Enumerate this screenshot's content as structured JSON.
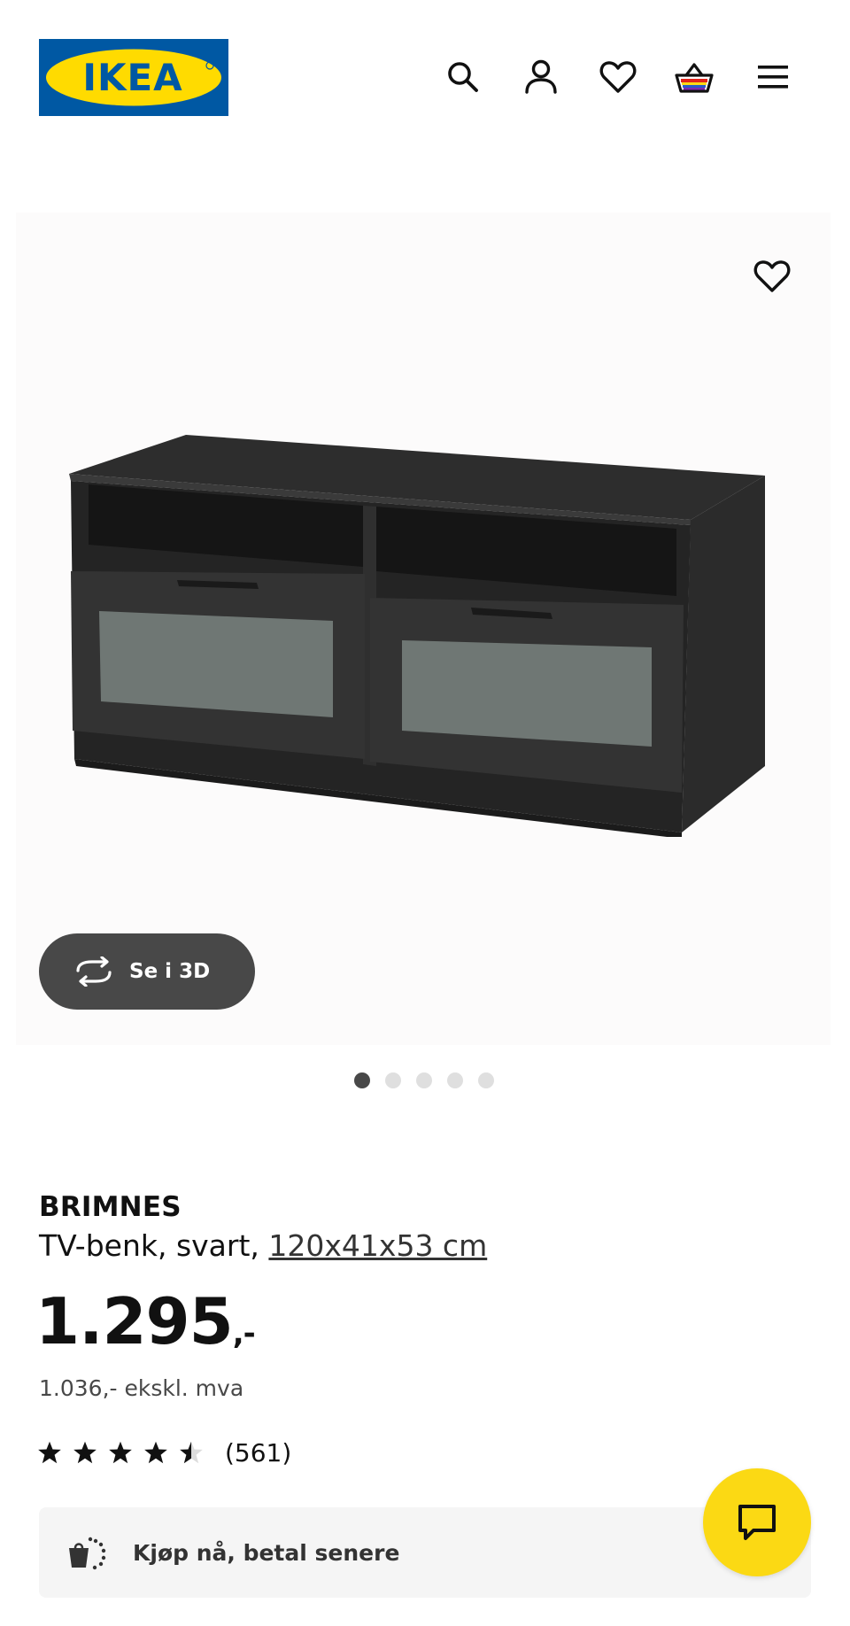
{
  "header": {
    "logo_text": "IKEA",
    "icons": [
      "search-icon",
      "account-icon",
      "heart-icon",
      "cart-icon",
      "menu-icon"
    ]
  },
  "gallery": {
    "favourite_icon": "heart-icon",
    "view_3d_label": "Se i 3D",
    "view_3d_icon": "rotate-3d-icon",
    "slide_count": 5,
    "active_slide": 1
  },
  "product": {
    "name": "BRIMNES",
    "description_prefix": "TV-benk, svart, ",
    "dimensions": "120x41x53 cm",
    "price": "1.295",
    "price_suffix": ",-",
    "price_excl_vat": "1.036,- ekskl. mva",
    "rating_value": 4.5,
    "rating_max": 5,
    "review_count": "(561)"
  },
  "bnpl": {
    "label": "Kjøp nå, betal senere",
    "icon": "buy-now-pay-later-icon"
  },
  "chat": {
    "icon": "chat-icon"
  },
  "colors": {
    "ikea_blue": "#0058a3",
    "ikea_yellow": "#ffdb00",
    "chat_yellow": "#fbd914",
    "button_dark": "#484848"
  }
}
